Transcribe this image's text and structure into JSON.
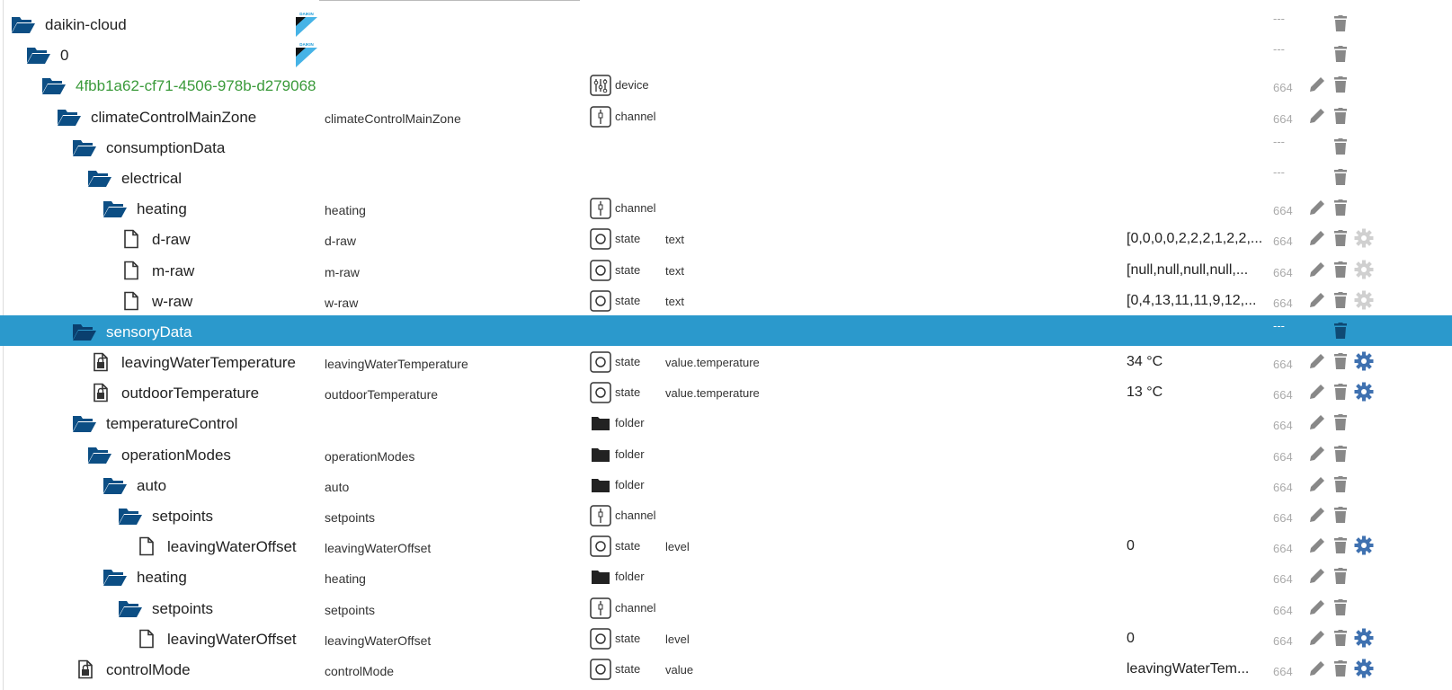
{
  "colors": {
    "folder": "#0c4e84",
    "selected_row": "#2b99cc",
    "device_link": "#3a9a3a",
    "gear_active": "#3f71b0",
    "gear_inactive": "#d0d0d0",
    "action_gray": "#888888"
  },
  "brand": {
    "logo_text": "DAIKIN"
  },
  "rows": [
    {
      "indent": 0,
      "icon": "folder-open-icon",
      "name": "daikin-cloud",
      "logo": true,
      "count": "---",
      "actions": [
        "trash"
      ]
    },
    {
      "indent": 1,
      "icon": "folder-open-icon",
      "name": "0",
      "logo": true,
      "count": "---",
      "actions": [
        "trash"
      ]
    },
    {
      "indent": 2,
      "icon": "folder-open-icon",
      "name": "4fbb1a62-cf71-4506-978b-d279068",
      "green": true,
      "type_icon": "device-icon",
      "type": "device",
      "count": "664",
      "actions": [
        "pencil",
        "trash"
      ]
    },
    {
      "indent": 3,
      "icon": "folder-open-icon",
      "name": "climateControlMainZone",
      "label": "climateControlMainZone",
      "type_icon": "channel-icon",
      "type": "channel",
      "count": "664",
      "actions": [
        "pencil",
        "trash"
      ]
    },
    {
      "indent": 4,
      "icon": "folder-open-icon",
      "name": "consumptionData",
      "count": "---",
      "actions": [
        "trash"
      ]
    },
    {
      "indent": 5,
      "icon": "folder-open-icon",
      "name": "electrical",
      "count": "---",
      "actions": [
        "trash"
      ]
    },
    {
      "indent": 6,
      "icon": "folder-open-icon",
      "name": "heating",
      "label": "heating",
      "type_icon": "channel-icon",
      "type": "channel",
      "count": "664",
      "actions": [
        "pencil",
        "trash"
      ]
    },
    {
      "indent": 7,
      "icon": "file-icon",
      "name": "d-raw",
      "label": "d-raw",
      "type_icon": "state-icon",
      "type": "state",
      "role": "text",
      "value": "[0,0,0,0,2,2,2,1,2,2,...",
      "count": "664",
      "actions": [
        "pencil",
        "trash",
        "gear-off"
      ]
    },
    {
      "indent": 7,
      "icon": "file-icon",
      "name": "m-raw",
      "label": "m-raw",
      "type_icon": "state-icon",
      "type": "state",
      "role": "text",
      "value": "[null,null,null,null,...",
      "count": "664",
      "actions": [
        "pencil",
        "trash",
        "gear-off"
      ]
    },
    {
      "indent": 7,
      "icon": "file-icon",
      "name": "w-raw",
      "label": "w-raw",
      "type_icon": "state-icon",
      "type": "state",
      "role": "text",
      "value": "[0,4,13,11,11,9,12,...",
      "count": "664",
      "actions": [
        "pencil",
        "trash",
        "gear-off"
      ]
    },
    {
      "indent": 4,
      "icon": "folder-open-icon",
      "name": "sensoryData",
      "selected": true,
      "count": "---",
      "actions": [
        "trash"
      ]
    },
    {
      "indent": 5,
      "icon": "file-lock-icon",
      "name": "leavingWaterTemperature",
      "label": "leavingWaterTemperature",
      "type_icon": "state-icon",
      "type": "state",
      "role": "value.temperature",
      "value": "34 °C",
      "count": "664",
      "actions": [
        "pencil",
        "trash",
        "gear"
      ]
    },
    {
      "indent": 5,
      "icon": "file-lock-icon",
      "name": "outdoorTemperature",
      "label": "outdoorTemperature",
      "type_icon": "state-icon",
      "type": "state",
      "role": "value.temperature",
      "value": "13 °C",
      "count": "664",
      "actions": [
        "pencil",
        "trash",
        "gear"
      ]
    },
    {
      "indent": 4,
      "icon": "folder-open-icon",
      "name": "temperatureControl",
      "type_icon": "folder-icon",
      "type": "folder",
      "count": "664",
      "actions": [
        "pencil",
        "trash"
      ]
    },
    {
      "indent": 5,
      "icon": "folder-open-icon",
      "name": "operationModes",
      "label": "operationModes",
      "type_icon": "folder-icon",
      "type": "folder",
      "count": "664",
      "actions": [
        "pencil",
        "trash"
      ]
    },
    {
      "indent": 6,
      "icon": "folder-open-icon",
      "name": "auto",
      "label": "auto",
      "type_icon": "folder-icon",
      "type": "folder",
      "count": "664",
      "actions": [
        "pencil",
        "trash"
      ]
    },
    {
      "indent": 7,
      "icon": "folder-open-icon",
      "name": "setpoints",
      "label": "setpoints",
      "type_icon": "channel-icon",
      "type": "channel",
      "count": "664",
      "actions": [
        "pencil",
        "trash"
      ]
    },
    {
      "indent": 8,
      "icon": "file-icon",
      "name": "leavingWaterOffset",
      "label": "leavingWaterOffset",
      "type_icon": "state-icon",
      "type": "state",
      "role": "level",
      "value": "0",
      "count": "664",
      "actions": [
        "pencil",
        "trash",
        "gear"
      ]
    },
    {
      "indent": 6,
      "icon": "folder-open-icon",
      "name": "heating",
      "label": "heating",
      "type_icon": "folder-icon",
      "type": "folder",
      "count": "664",
      "actions": [
        "pencil",
        "trash"
      ]
    },
    {
      "indent": 7,
      "icon": "folder-open-icon",
      "name": "setpoints",
      "label": "setpoints",
      "type_icon": "channel-icon",
      "type": "channel",
      "count": "664",
      "actions": [
        "pencil",
        "trash"
      ]
    },
    {
      "indent": 8,
      "icon": "file-icon",
      "name": "leavingWaterOffset",
      "label": "leavingWaterOffset",
      "type_icon": "state-icon",
      "type": "state",
      "role": "level",
      "value": "0",
      "count": "664",
      "actions": [
        "pencil",
        "trash",
        "gear"
      ]
    },
    {
      "indent": 4,
      "icon": "file-lock-icon",
      "name": "controlMode",
      "label": "controlMode",
      "type_icon": "state-icon",
      "type": "state",
      "role": "value",
      "value": "leavingWaterTem...",
      "count": "664",
      "actions": [
        "pencil",
        "trash",
        "gear"
      ]
    }
  ]
}
